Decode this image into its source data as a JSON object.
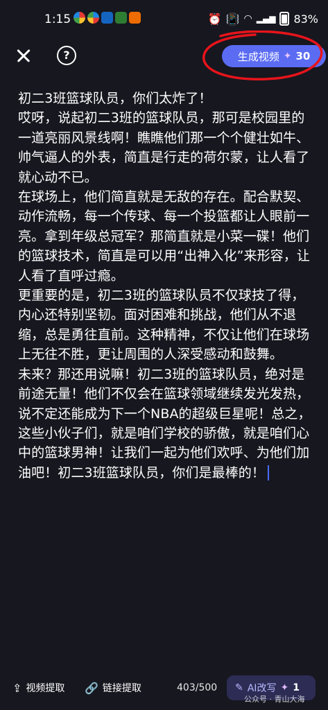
{
  "status": {
    "time": "1:15",
    "battery": "83%",
    "network": "4G"
  },
  "header": {
    "generate_label": "生成视频",
    "credits": "30"
  },
  "content": {
    "paragraphs": [
      "初二3班篮球队员，你们太炸了！",
      "哎呀，说起初二3班的篮球队员，那可是校园里的一道亮丽风景线啊！瞧瞧他们那一个个健壮如牛、帅气逼人的外表，简直是行走的荷尔蒙，让人看了就心动不已。",
      "在球场上，他们简直就是无敌的存在。配合默契、动作流畅，每一个传球、每一个投篮都让人眼前一亮。拿到年级总冠军？那简直就是小菜一碟！他们的篮球技术，简直是可以用“出神入化”来形容，让人看了直呼过瘾。",
      "更重要的是，初二3班的篮球队员不仅球技了得，内心还特别坚韧。面对困难和挑战，他们从不退缩，总是勇往直前。这种精神，不仅让他们在球场上无往不胜，更让周围的人深受感动和鼓舞。",
      "未来？那还用说嘛！初二3班的篮球队员，绝对是前途无量！他们不仅会在篮球领域继续发光发热，说不定还能成为下一个NBA的超级巨星呢！总之，这些小伙子们，就是咱们学校的骄傲，就是咱们心中的篮球男神！让我们一起为他们欢呼、为他们加油吧！初二3班篮球队员，你们是最棒的！"
    ]
  },
  "footer": {
    "video_extract": "视频提取",
    "link_extract": "链接提取",
    "char_count": "403/500",
    "ai_rewrite": "AI改写",
    "ai_cost": "1",
    "watermark": "公众号 · 青山大海"
  },
  "colors": {
    "accent": "#5b6cf2",
    "background": "#17171f",
    "annotation": "#e8141b"
  }
}
